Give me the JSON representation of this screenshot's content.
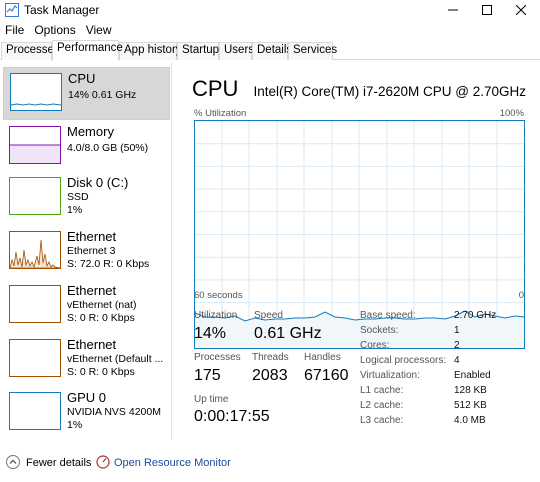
{
  "window": {
    "title": "Task Manager"
  },
  "menu": [
    "File",
    "Options",
    "View"
  ],
  "tabs": [
    "Processes",
    "Performance",
    "App history",
    "Startup",
    "Users",
    "Details",
    "Services"
  ],
  "sidebar": [
    {
      "name": "CPU",
      "sub1": "14% 0.61 GHz",
      "sub2": "",
      "sub3": "",
      "color": "#117dbb"
    },
    {
      "name": "Memory",
      "sub1": "4.0/8.0 GB (50%)",
      "sub2": "",
      "sub3": "",
      "color": "#8b12ae"
    },
    {
      "name": "Disk 0 (C:)",
      "sub1": "SSD",
      "sub2": "1%",
      "sub3": "",
      "color": "#4da60c"
    },
    {
      "name": "Ethernet",
      "sub1": "Ethernet 3",
      "sub2": "S: 72.0  R: 0 Kbps",
      "sub3": "",
      "color": "#a74f01"
    },
    {
      "name": "Ethernet",
      "sub1": "vEthernet (nat)",
      "sub2": "S: 0  R: 0 Kbps",
      "sub3": "",
      "color": "#a74f01"
    },
    {
      "name": "Ethernet",
      "sub1": "vEthernet (Default ...",
      "sub2": "S: 0  R: 0 Kbps",
      "sub3": "",
      "color": "#a74f01"
    },
    {
      "name": "GPU 0",
      "sub1": "NVIDIA NVS 4200M",
      "sub2": "1%",
      "sub3": "",
      "color": "#117dbb"
    }
  ],
  "main": {
    "title": "CPU",
    "cpu_name": "Intel(R) Core(TM) i7-2620M CPU @ 2.70GHz",
    "util_label": "% Utilization",
    "util_max": "100%",
    "time_left": "60 seconds",
    "time_right": "0",
    "stats": {
      "utilization_label": "Utilization",
      "utilization": "14%",
      "speed_label": "Speed",
      "speed": "0.61 GHz",
      "processes_label": "Processes",
      "processes": "175",
      "threads_label": "Threads",
      "threads": "2083",
      "handles_label": "Handles",
      "handles": "67160",
      "uptime_label": "Up time",
      "uptime": "0:00:17:55"
    },
    "specs": [
      {
        "k": "Base speed:",
        "v": "2.70 GHz"
      },
      {
        "k": "Sockets:",
        "v": "1"
      },
      {
        "k": "Cores:",
        "v": "2"
      },
      {
        "k": "Logical processors:",
        "v": "4"
      },
      {
        "k": "Virtualization:",
        "v": "Enabled"
      },
      {
        "k": "L1 cache:",
        "v": "128 KB"
      },
      {
        "k": "L2 cache:",
        "v": "512 KB"
      },
      {
        "k": "L3 cache:",
        "v": "4.0 MB"
      }
    ]
  },
  "footer": {
    "fewer": "Fewer details",
    "resource_monitor": "Open Resource Monitor"
  }
}
